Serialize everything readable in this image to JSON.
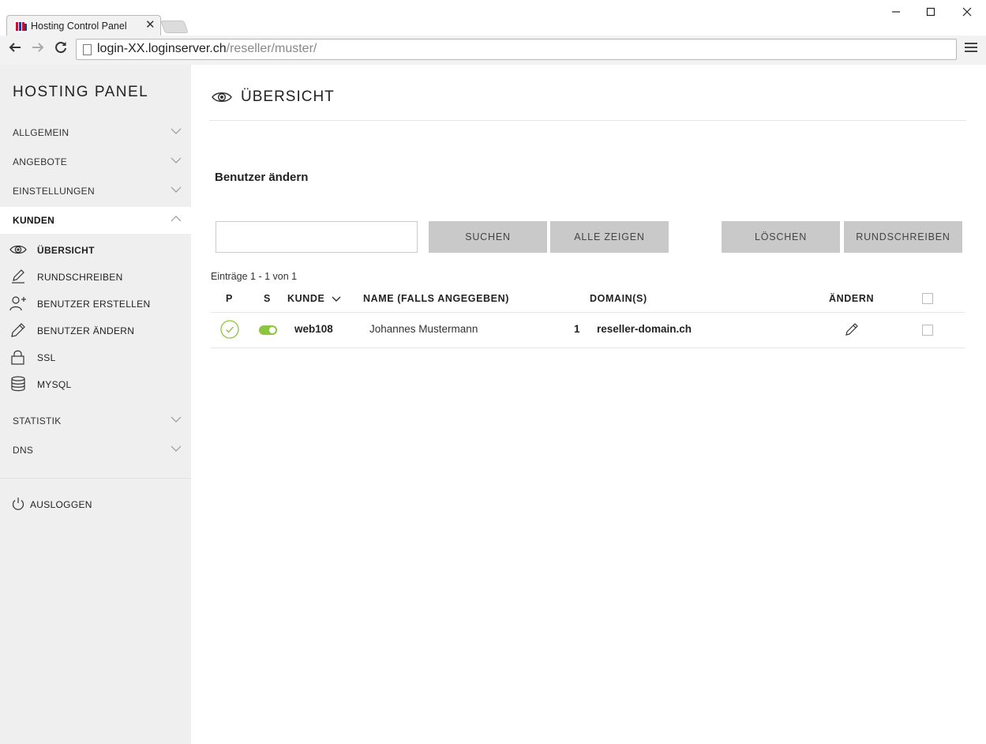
{
  "browser": {
    "tab_title": "Hosting Control Panel",
    "tab_close": "✕",
    "url_host": "login-XX.loginserver.ch",
    "url_path": "/reseller/muster/",
    "window_controls": {
      "minimize": "—",
      "maximize": "☐",
      "close": "✕"
    },
    "nav": {
      "back": "←",
      "forward": "→",
      "reload": "↻"
    }
  },
  "sidebar": {
    "brand": "HOSTING PANEL",
    "menu": [
      {
        "label": "ALLGEMEIN",
        "expanded": false
      },
      {
        "label": "ANGEBOTE",
        "expanded": false
      },
      {
        "label": "EINSTELLUNGEN",
        "expanded": false
      },
      {
        "label": "KUNDEN",
        "expanded": true
      },
      {
        "label": "STATISTIK",
        "expanded": false
      },
      {
        "label": "DNS",
        "expanded": false
      }
    ],
    "kunden_submenu": [
      {
        "label": "ÜBERSICHT",
        "icon": "eye-icon",
        "current": true
      },
      {
        "label": "RUNDSCHREIBEN",
        "icon": "pencil-square-icon"
      },
      {
        "label": "BENUTZER ERSTELLEN",
        "icon": "user-plus-icon"
      },
      {
        "label": "BENUTZER ÄNDERN",
        "icon": "pencil-icon"
      },
      {
        "label": "SSL",
        "icon": "lock-icon"
      },
      {
        "label": "MYSQL",
        "icon": "database-icon"
      }
    ],
    "logout": "AUSLOGGEN"
  },
  "main": {
    "page_title": "ÜBERSICHT",
    "section_title": "Benutzer ändern",
    "search": {
      "value": "",
      "placeholder": ""
    },
    "buttons": {
      "search": "SUCHEN",
      "show_all": "ALLE ZEIGEN",
      "delete": "LÖSCHEN",
      "newsletter": "RUNDSCHREIBEN"
    },
    "entries_info": "Einträge 1 - 1 von 1",
    "table": {
      "headers": {
        "p": "P",
        "s": "S",
        "kunde": "KUNDE",
        "name": "NAME (FALLS ANGEGEBEN)",
        "domains": "DOMAIN(S)",
        "edit": "ÄNDERN"
      },
      "rows": [
        {
          "p_status": "ok",
          "s_enabled": true,
          "kunde": "web108",
          "name": "Johannes Mustermann",
          "domain_count": "1",
          "domain": "reseller-domain.ch",
          "selected": false
        }
      ]
    },
    "colors": {
      "accent_green": "#8cc63f",
      "button_gray": "#c9c9c9",
      "sidebar_bg": "#efefef"
    }
  }
}
